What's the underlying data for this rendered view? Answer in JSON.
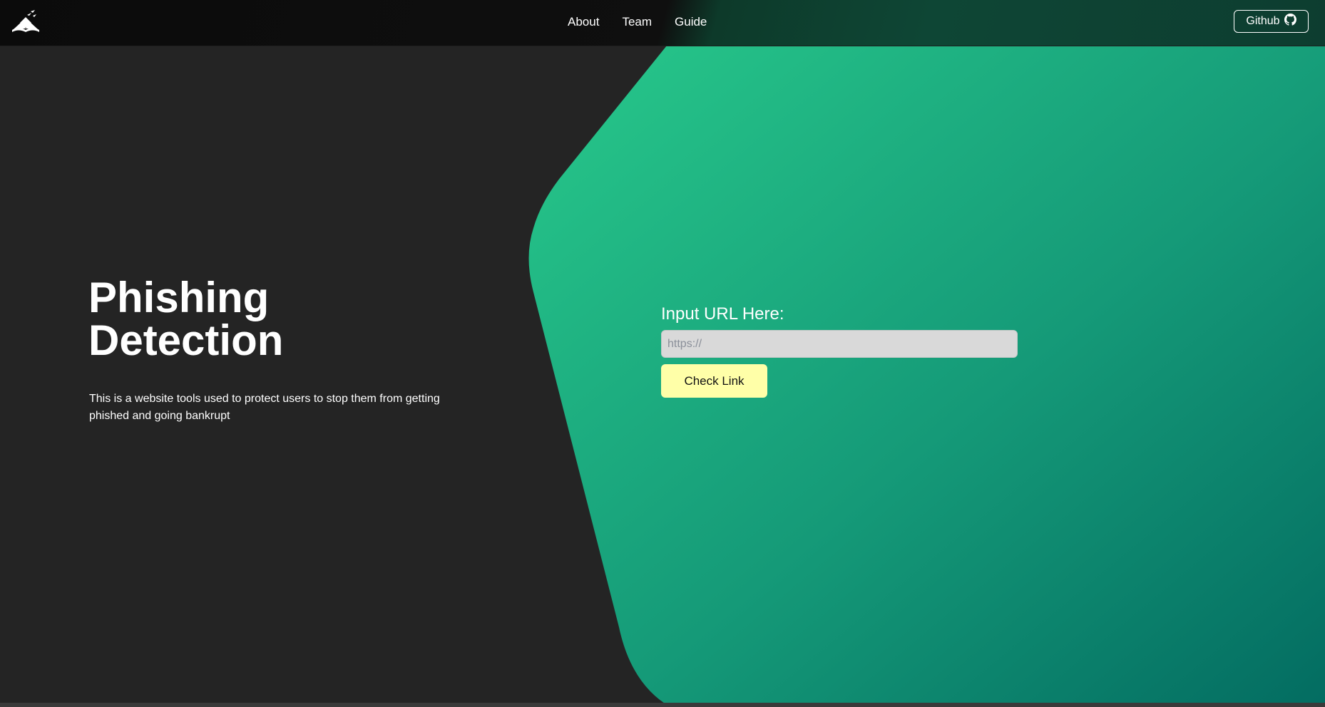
{
  "nav": {
    "logo_icon": "open-book-logo-icon",
    "links": [
      {
        "label": "About"
      },
      {
        "label": "Team"
      },
      {
        "label": "Guide"
      }
    ],
    "github_label": "Github",
    "github_icon": "github-icon"
  },
  "hero": {
    "title_line1": "Phishing",
    "title_line2": "Detection",
    "description": "This is a website tools used to protect users to stop them from getting phished and going bankrupt"
  },
  "form": {
    "label": "Input URL Here:",
    "input_placeholder": "https://",
    "input_value": "",
    "button_label": "Check Link"
  },
  "colors": {
    "background": "#242424",
    "green_light": "#26c089",
    "green_dark": "#047568",
    "button_yellow": "#ffffa8"
  }
}
